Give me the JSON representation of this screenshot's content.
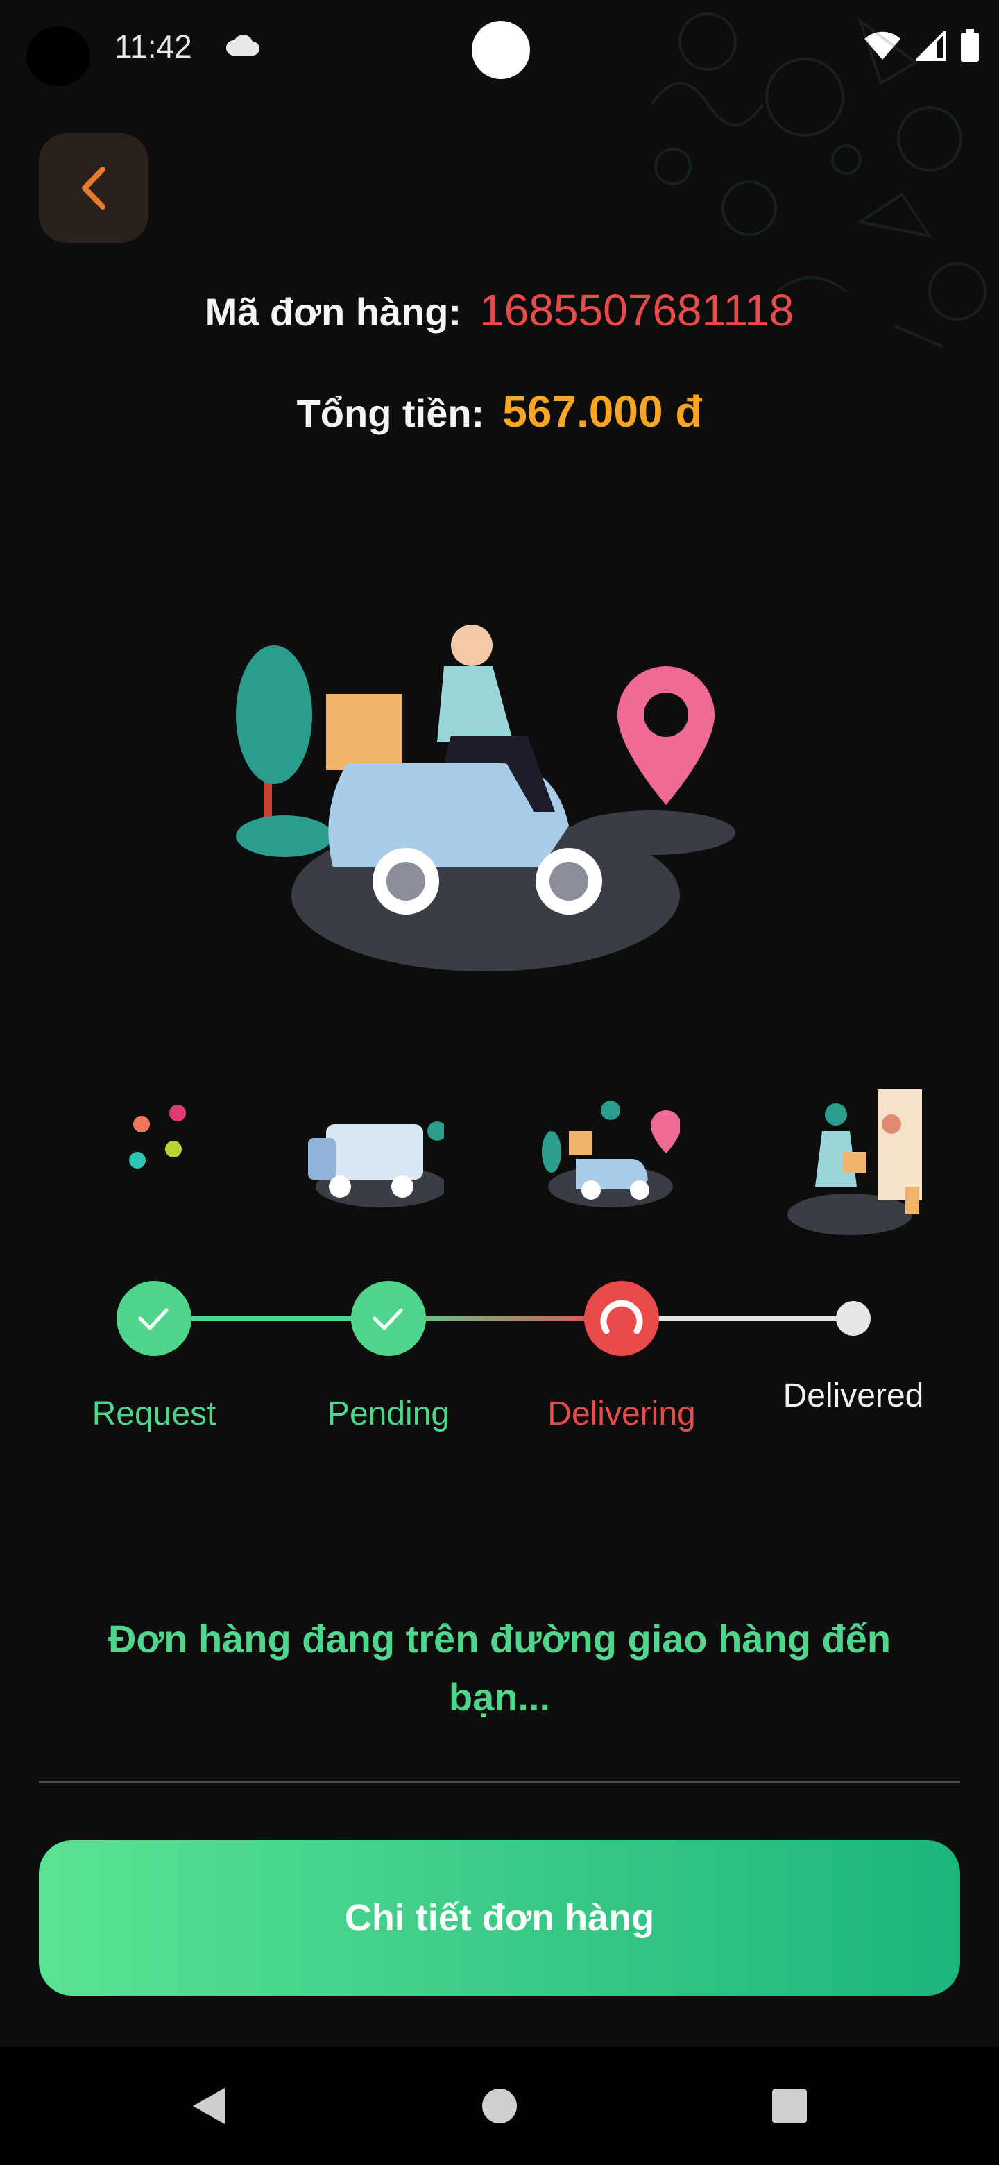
{
  "status_bar": {
    "time": "11:42"
  },
  "order": {
    "id_label": "Mã đơn hàng:",
    "id_value": "1685507681118",
    "total_label": "Tổng tiền:",
    "total_value": "567.000 đ"
  },
  "steps": [
    {
      "label": "Request",
      "state": "done"
    },
    {
      "label": "Pending",
      "state": "done"
    },
    {
      "label": "Delivering",
      "state": "active"
    },
    {
      "label": "Delivered",
      "state": "todo"
    }
  ],
  "message": "Đơn hàng đang trên đường giao hàng đến bạn...",
  "button": {
    "label": "Chi tiết đơn hàng"
  },
  "colors": {
    "done": "#4fd68c",
    "active": "#e94b4b",
    "todo": "#e6e6e6",
    "accent_orange": "#f6a623"
  },
  "icons": {
    "back": "chevron-left-icon",
    "cloud": "cloud-icon",
    "wifi": "wifi-icon",
    "signal": "signal-icon",
    "battery": "battery-icon"
  }
}
